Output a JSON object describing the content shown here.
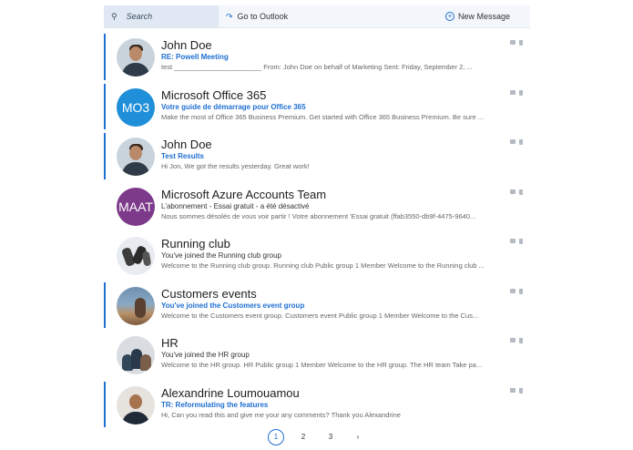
{
  "toolbar": {
    "search_placeholder": "Search",
    "search_icon": "search-icon",
    "goto_label": "Go to Outlook",
    "goto_icon": "arrow-redirect-icon",
    "new_message_label": "New Message",
    "new_message_icon": "plus-circle-icon"
  },
  "accent_color": "#1f6fd1",
  "messages": [
    {
      "sender": "John Doe",
      "subject": "RE: Powell Meeting",
      "preview": "test _______________________ From: John Doe on behalf of Marketing Sent: Friday, September 2, ...",
      "unread": true,
      "avatar": "photo-man"
    },
    {
      "sender": "Microsoft Office 365",
      "subject": "Votre guide de démarrage pour Office 365",
      "preview": "Make the most of Office 365 Business Premium. Get started with Office 365 Business Premium. Be sure ...",
      "unread": true,
      "avatar_initials": "MO3"
    },
    {
      "sender": "John Doe",
      "subject": "Test Results",
      "preview": "Hi Jon, We got the results yesterday. Great work!",
      "unread": true,
      "avatar": "photo-man"
    },
    {
      "sender": "Microsoft Azure Accounts Team",
      "subject": "L'abonnement - Essai gratuit - a été désactivé",
      "preview": "Nous sommes désolés de vous voir partir ! Votre abonnement 'Essai gratuit (ffab3550-db9f-4475-9640...",
      "unread": false,
      "avatar_initials": "MAAT"
    },
    {
      "sender": "Running club",
      "subject": "You've joined the Running club group",
      "preview": "Welcome to the Running club group. Running club Public group 1 Member Welcome to the Running club ...",
      "unread": false,
      "avatar": "photo-runners"
    },
    {
      "sender": "Customers events",
      "subject": "You've joined the Customers event group",
      "preview": "Welcome to the Customers event group. Customers event Public group 1 Member Welcome to the Cus...",
      "unread": true,
      "avatar": "photo-beach"
    },
    {
      "sender": "HR",
      "subject": "You've joined the HR group",
      "preview": "Welcome to the HR group. HR Public group 1 Member Welcome to the HR group. The HR team Take pa...",
      "unread": false,
      "avatar": "photo-team"
    },
    {
      "sender": "Alexandrine Loumouamou",
      "subject": "TR: Reformulating the features",
      "preview": "Hi, Can you read this and give me your any comments? Thank you Alexandrine",
      "unread": true,
      "avatar": "photo-woman"
    }
  ],
  "pagination": {
    "pages": [
      "1",
      "2",
      "3"
    ],
    "current": "1",
    "next": "›"
  }
}
